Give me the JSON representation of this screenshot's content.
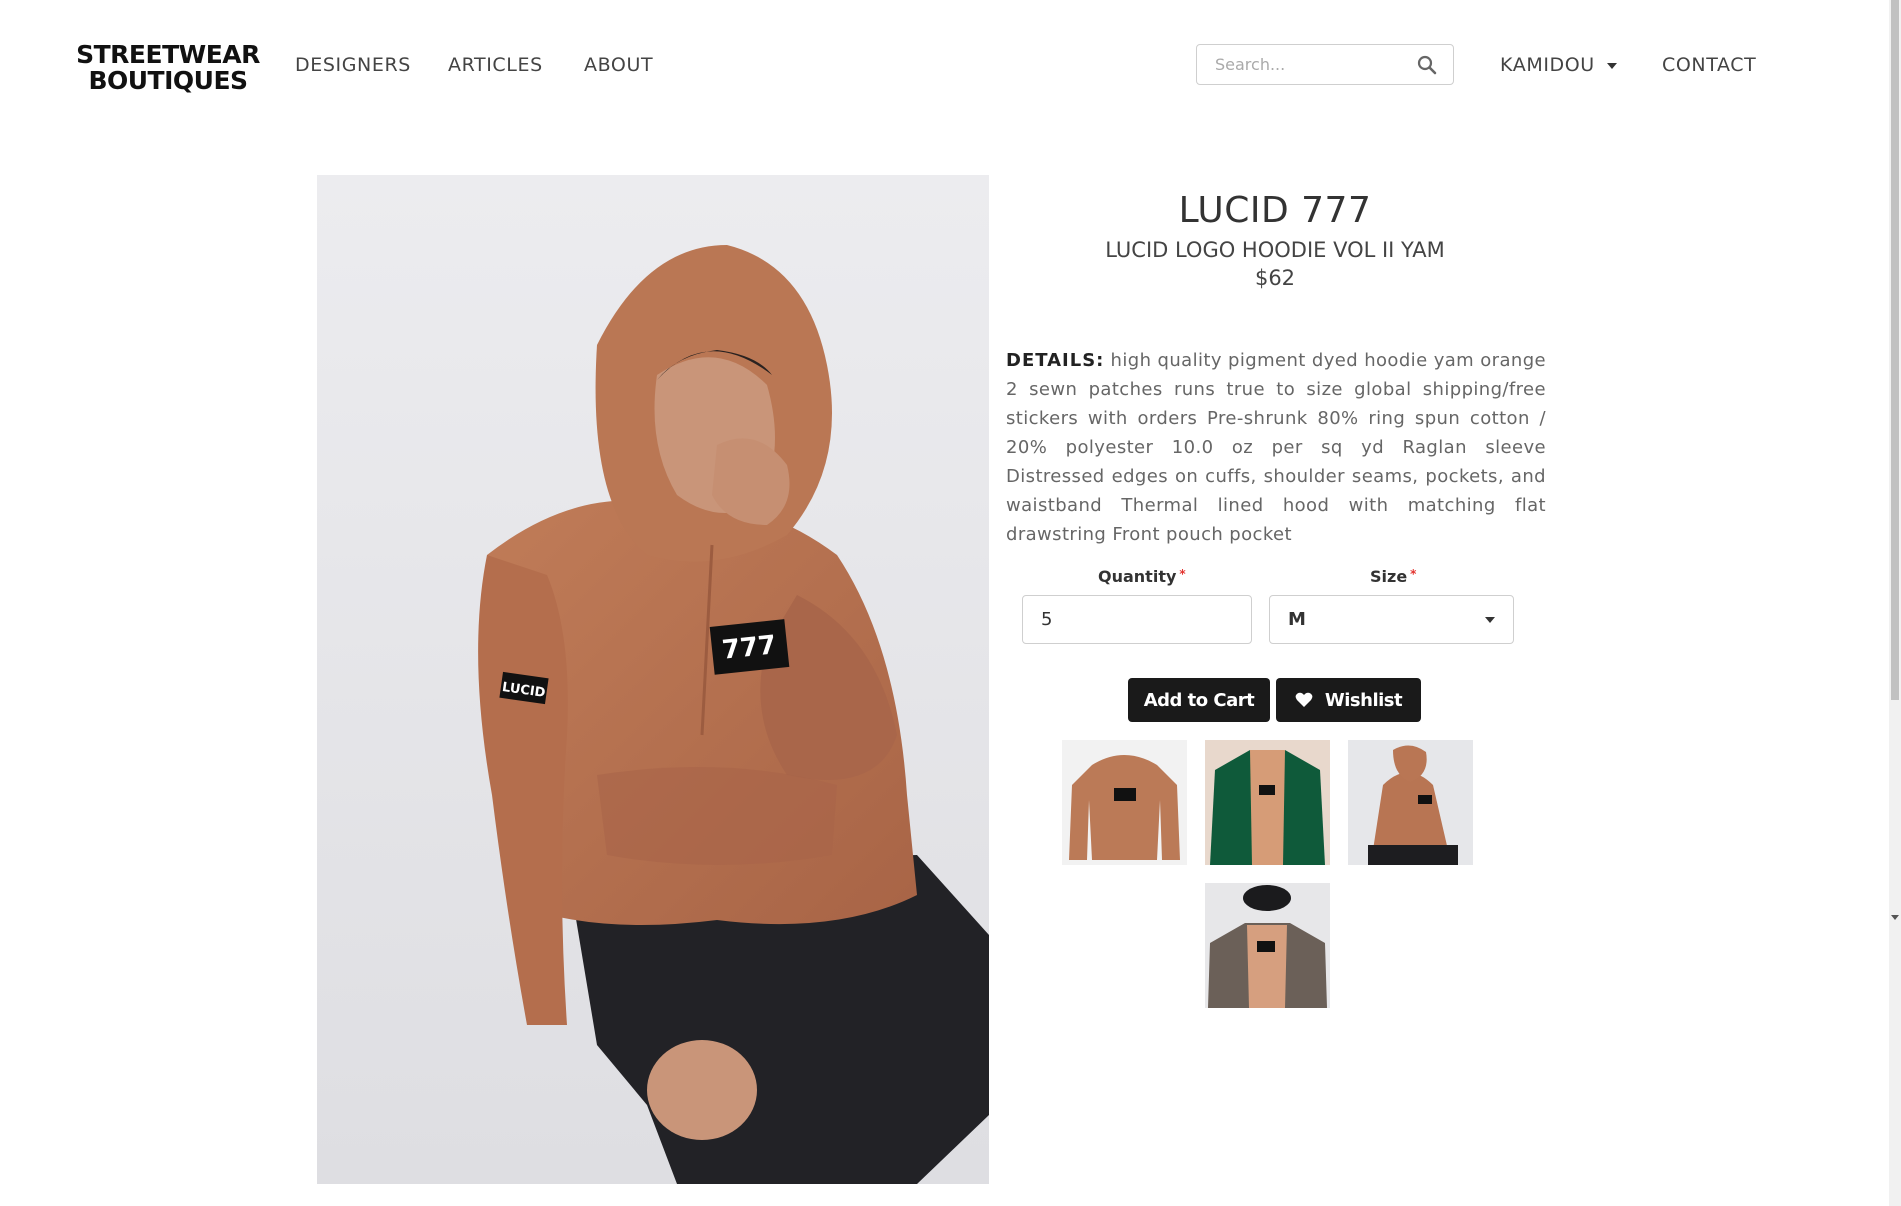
{
  "header": {
    "logo_line1": "STREETWEAR",
    "logo_line2": "BOUTIQUES",
    "nav": {
      "designers": "DESIGNERS",
      "articles": "ARTICLES",
      "about": "ABOUT",
      "user": "KAMIDOU",
      "contact": "CONTACT"
    },
    "search": {
      "placeholder": "Search...",
      "value": ""
    }
  },
  "product": {
    "brand": "LUCID 777",
    "name": "LUCID LOGO HOODIE VOL II YAM",
    "price": "$62",
    "details_label": "DETAILS:",
    "details_text": "high quality pigment dyed hoodie yam orange 2 sewn patches runs true to size global shipping/free stickers with orders Pre-shrunk 80% ring spun cotton / 20% polyester 10.0 oz per sq yd Raglan sleeve Distressed edges on cuffs, shoulder seams, pockets, and waistband Thermal lined hood with matching flat drawstring Front pouch pocket",
    "patch_text": "777",
    "sleeve_text": "LUCID"
  },
  "form": {
    "quantity_label": "Quantity",
    "quantity_value": "5",
    "size_label": "Size",
    "size_value": "M",
    "required_mark": "*"
  },
  "actions": {
    "add_to_cart": "Add to Cart",
    "wishlist": "Wishlist"
  },
  "colors": {
    "hoodie": "#b97452",
    "hoodie_dark": "#9a5b3f",
    "button_bg": "#1a1a1a",
    "required": "#e3342f"
  },
  "icons": {
    "search": "search-icon",
    "dropdown": "caret-down-icon",
    "wishlist": "heart-icon"
  }
}
